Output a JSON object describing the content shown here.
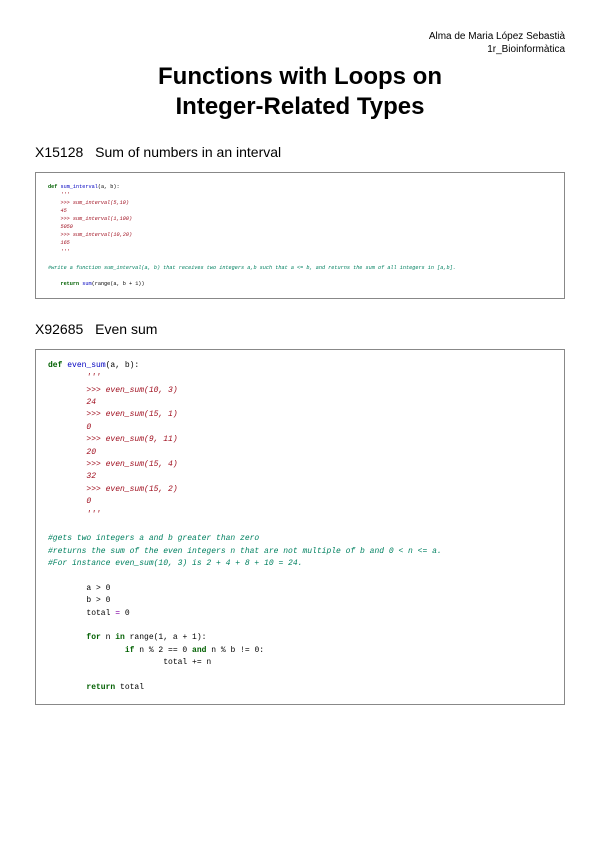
{
  "header": {
    "author": "Alma de Maria López Sebastià",
    "course": "1r_Bioinformàtica"
  },
  "title": {
    "line1": "Functions with Loops on",
    "line2": "Integer-Related Types"
  },
  "sections": [
    {
      "id": "X15128",
      "name": "Sum of numbers in an interval",
      "code": {
        "def_kw": "def",
        "fn_name": "sum_interval",
        "params": "(a, b):",
        "doc_open": "    '''",
        "d1": "    >>> sum_interval(5,10)",
        "d2": "    45",
        "d3": "    >>> sum_interval(1,100)",
        "d4": "    5050",
        "d5": "    >>> sum_interval(10,20)",
        "d6": "    165",
        "doc_close": "    '''",
        "comment": "#write a function sum_interval(a, b) that receives two integers a,b such that a <= b, and returns the sum of all integers in [a,b].",
        "ret_kw": "return",
        "ret_call": "sum",
        "ret_rest": "(range(a, b + 1))"
      }
    },
    {
      "id": "X92685",
      "name": "Even sum",
      "code": {
        "def_kw": "def",
        "fn_name": "even_sum",
        "params": "(a, b):",
        "doc_open": "        '''",
        "d1": "        >>> even_sum(10, 3)",
        "d2": "        24",
        "d3": "        >>> even_sum(15, 1)",
        "d4": "        0",
        "d5": "        >>> even_sum(9, 11)",
        "d6": "        20",
        "d7": "        >>> even_sum(15, 4)",
        "d8": "        32",
        "d9": "        >>> even_sum(15, 2)",
        "d10": "        0",
        "doc_close": "        '''",
        "c1": "#gets two integers a and b greater than zero",
        "c2": "#returns the sum of the even integers n that are not multiple of b and 0 < n <= a.",
        "c3": "#For instance even_sum(10, 3) is 2 + 4 + 8 + 10 = 24.",
        "body1_a": "        a > 0",
        "body1_b": "        b > 0",
        "body2_lhs": "        total",
        "body2_eq": " = ",
        "body2_rhs": "0",
        "for_kw": "for",
        "for_var": " n ",
        "in_kw": "in",
        "for_range": " range(1, a + 1):",
        "if_kw": "if",
        "if_cond1": " n % 2 == 0 ",
        "and_kw": "and",
        "if_cond2": " n % b != 0:",
        "if_body": "                        total += n",
        "ret_kw": "return",
        "ret_val": " total"
      }
    }
  ]
}
